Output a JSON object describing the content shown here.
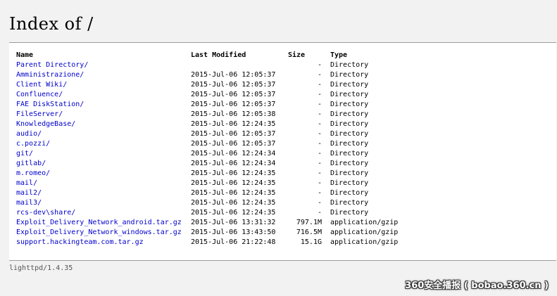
{
  "heading": "Index of /",
  "columns": {
    "name": "Name",
    "modified": "Last Modified",
    "size": "Size",
    "type": "Type"
  },
  "rows": [
    {
      "name": "Parent Directory/",
      "modified": "",
      "size": "-",
      "type": "Directory"
    },
    {
      "name": "Amministrazione/",
      "modified": "2015-Jul-06 12:05:37",
      "size": "-",
      "type": "Directory"
    },
    {
      "name": "Client Wiki/",
      "modified": "2015-Jul-06 12:05:37",
      "size": "-",
      "type": "Directory"
    },
    {
      "name": "Confluence/",
      "modified": "2015-Jul-06 12:05:37",
      "size": "-",
      "type": "Directory"
    },
    {
      "name": "FAE DiskStation/",
      "modified": "2015-Jul-06 12:05:37",
      "size": "-",
      "type": "Directory"
    },
    {
      "name": "FileServer/",
      "modified": "2015-Jul-06 12:05:38",
      "size": "-",
      "type": "Directory"
    },
    {
      "name": "KnowledgeBase/",
      "modified": "2015-Jul-06 12:24:35",
      "size": "-",
      "type": "Directory"
    },
    {
      "name": "audio/",
      "modified": "2015-Jul-06 12:05:37",
      "size": "-",
      "type": "Directory"
    },
    {
      "name": "c.pozzi/",
      "modified": "2015-Jul-06 12:05:37",
      "size": "-",
      "type": "Directory"
    },
    {
      "name": "git/",
      "modified": "2015-Jul-06 12:24:34",
      "size": "-",
      "type": "Directory"
    },
    {
      "name": "gitlab/",
      "modified": "2015-Jul-06 12:24:34",
      "size": "-",
      "type": "Directory"
    },
    {
      "name": "m.romeo/",
      "modified": "2015-Jul-06 12:24:35",
      "size": "-",
      "type": "Directory"
    },
    {
      "name": "mail/",
      "modified": "2015-Jul-06 12:24:35",
      "size": "-",
      "type": "Directory"
    },
    {
      "name": "mail2/",
      "modified": "2015-Jul-06 12:24:35",
      "size": "-",
      "type": "Directory"
    },
    {
      "name": "mail3/",
      "modified": "2015-Jul-06 12:24:35",
      "size": "-",
      "type": "Directory"
    },
    {
      "name": "rcs-dev\\share/",
      "modified": "2015-Jul-06 12:24:35",
      "size": "-",
      "type": "Directory"
    },
    {
      "name": "Exploit_Delivery_Network_android.tar.gz",
      "modified": "2015-Jul-06 13:31:32",
      "size": "797.1M",
      "type": "application/gzip"
    },
    {
      "name": "Exploit_Delivery_Network_windows.tar.gz",
      "modified": "2015-Jul-06 13:43:50",
      "size": "716.5M",
      "type": "application/gzip"
    },
    {
      "name": "support.hackingteam.com.tar.gz",
      "modified": "2015-Jul-06 21:22:48",
      "size": "15.1G",
      "type": "application/gzip"
    }
  ],
  "server_info": "lighttpd/1.4.35",
  "watermark": "360安全播报 ( bobao.360.cn )",
  "colors": {
    "link": "#0000cc",
    "background": "#f2f2f2",
    "panel": "#ffffff"
  }
}
